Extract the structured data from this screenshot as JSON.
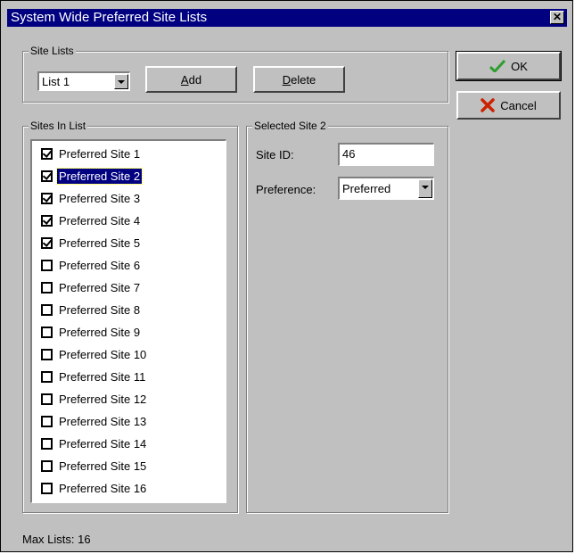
{
  "window": {
    "title": "System Wide Preferred Site Lists"
  },
  "site_lists": {
    "group_label": "Site Lists",
    "combo_value": "List 1",
    "add_label": "Add",
    "add_accel": "A",
    "add_rest": "dd",
    "delete_accel": "D",
    "delete_rest": "elete"
  },
  "sites_in_list": {
    "group_label": "Sites In List",
    "items": [
      {
        "label": "Preferred Site 1",
        "checked": true
      },
      {
        "label": "Preferred Site 2",
        "checked": true,
        "selected": true
      },
      {
        "label": "Preferred Site 3",
        "checked": true
      },
      {
        "label": "Preferred Site 4",
        "checked": true
      },
      {
        "label": "Preferred Site 5",
        "checked": true
      },
      {
        "label": "Preferred Site 6",
        "checked": false
      },
      {
        "label": "Preferred Site 7",
        "checked": false
      },
      {
        "label": "Preferred Site 8",
        "checked": false
      },
      {
        "label": "Preferred Site 9",
        "checked": false
      },
      {
        "label": "Preferred Site 10",
        "checked": false
      },
      {
        "label": "Preferred Site 11",
        "checked": false
      },
      {
        "label": "Preferred Site 12",
        "checked": false
      },
      {
        "label": "Preferred Site 13",
        "checked": false
      },
      {
        "label": "Preferred Site 14",
        "checked": false
      },
      {
        "label": "Preferred Site 15",
        "checked": false
      },
      {
        "label": "Preferred Site 16",
        "checked": false
      }
    ]
  },
  "selected_site": {
    "group_label": "Selected Site  2",
    "site_id_label": "Site ID:",
    "site_id_value": "46",
    "preference_label": "Preference:",
    "preference_value": "Preferred"
  },
  "buttons": {
    "ok_label": "OK",
    "cancel_label": "Cancel"
  },
  "footer": {
    "max_lists": "Max Lists: 16"
  },
  "colors": {
    "titlebar": "#000080",
    "face": "#c0c0c0",
    "ok_icon": "#2e9e2e",
    "cancel_icon": "#cc2200"
  }
}
